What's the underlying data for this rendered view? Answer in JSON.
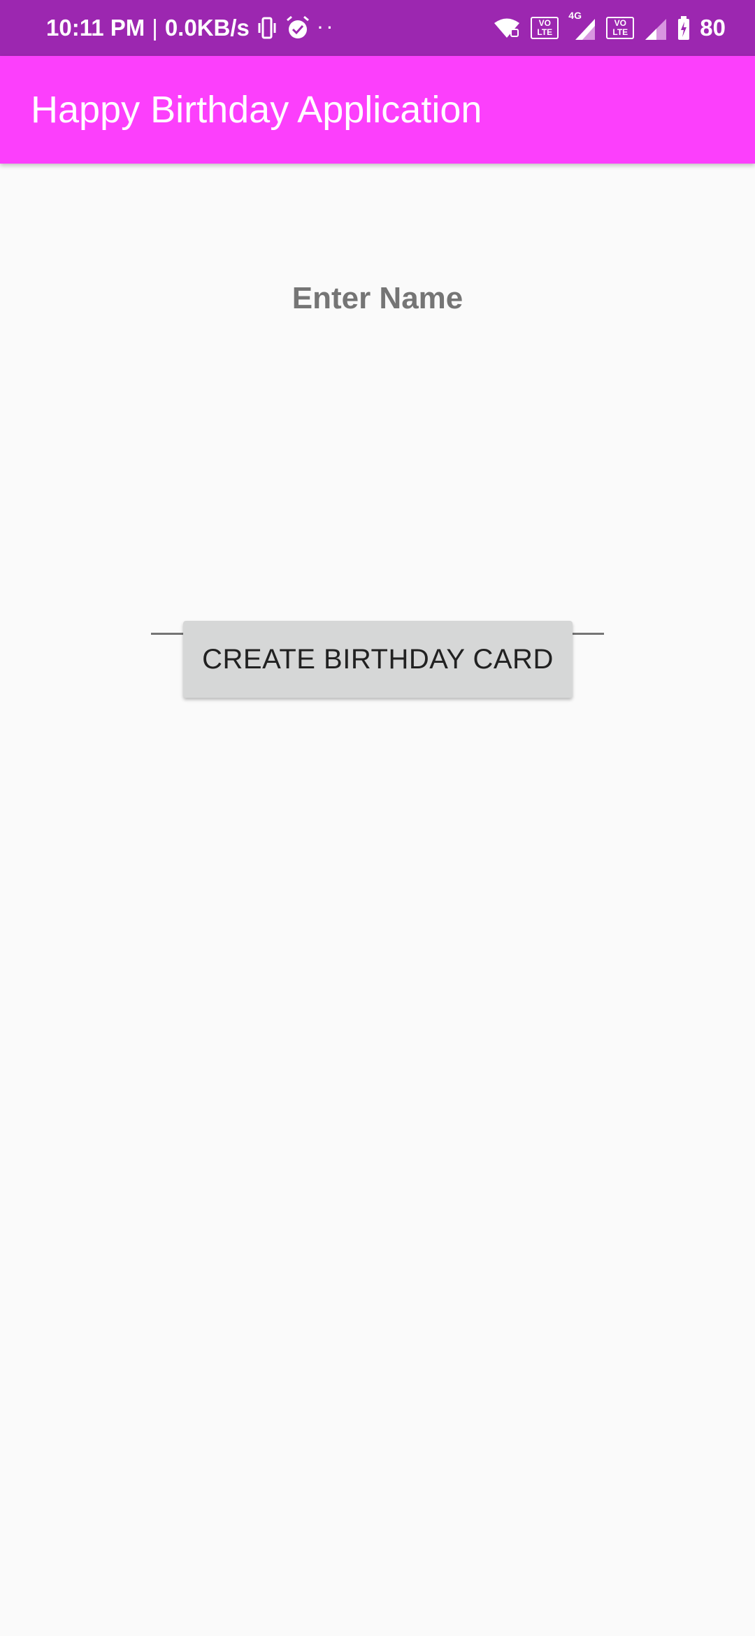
{
  "status_bar": {
    "time": "10:11 PM",
    "separator": "|",
    "network_speed": "0.0KB/s",
    "dots": "· ·",
    "volte_1": {
      "top": "VO",
      "bottom": "LTE"
    },
    "network_type": "4G",
    "volte_2": {
      "top": "VO",
      "bottom": "LTE"
    },
    "battery": "80",
    "icons": [
      "vibrate-icon",
      "alarm-icon",
      "wifi-icon",
      "signal-icon",
      "battery-icon"
    ]
  },
  "app_bar": {
    "title": "Happy Birthday Application",
    "color": "#fc3ffc"
  },
  "form": {
    "label": "Enter Name",
    "name_value": "",
    "name_placeholder": "",
    "button_label": "CREATE BIRTHDAY CARD"
  },
  "colors": {
    "status_bar": "#9c27b0",
    "background": "#fafafa",
    "label_text": "#757575",
    "button_bg": "#d6d7d7"
  }
}
